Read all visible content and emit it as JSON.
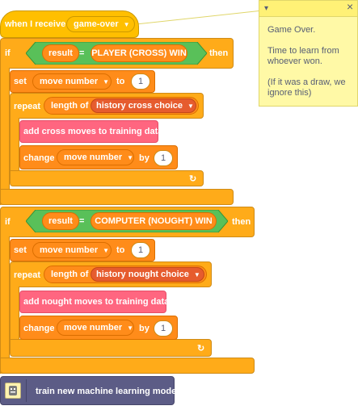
{
  "event_block": {
    "label": "when I receive",
    "message": "game-over"
  },
  "if1": {
    "if_label": "if",
    "then_label": "then",
    "result_label": "result",
    "equals": "=",
    "value": "PLAYER (CROSS) WIN",
    "set_label": "set",
    "set_var": "move number",
    "to_label": "to",
    "set_value": "1",
    "repeat_label": "repeat",
    "length_label": "length of",
    "list_name": "history cross choice",
    "ml_block": "add cross moves to training data",
    "change_label": "change",
    "change_var": "move number",
    "by_label": "by",
    "change_value": "1"
  },
  "if2": {
    "if_label": "if",
    "then_label": "then",
    "result_label": "result",
    "equals": "=",
    "value": "COMPUTER (NOUGHT) WIN",
    "set_label": "set",
    "set_var": "move number",
    "to_label": "to",
    "set_value": "1",
    "repeat_label": "repeat",
    "length_label": "length of",
    "list_name": "history nought choice",
    "ml_block": "add nought moves to training data",
    "change_label": "change",
    "change_var": "move number",
    "by_label": "by",
    "change_value": "1"
  },
  "train_block": {
    "label": "train new machine learning model"
  },
  "comment": {
    "collapse_glyph": "▾",
    "close_glyph": "×",
    "lines": [
      "Game Over.",
      "",
      "Time to learn from",
      "whoever won.",
      "",
      "(If it was a draw, we",
      "ignore this)"
    ]
  },
  "glyphs": {
    "dropdown": "▼",
    "loop_arrow": "↻"
  }
}
